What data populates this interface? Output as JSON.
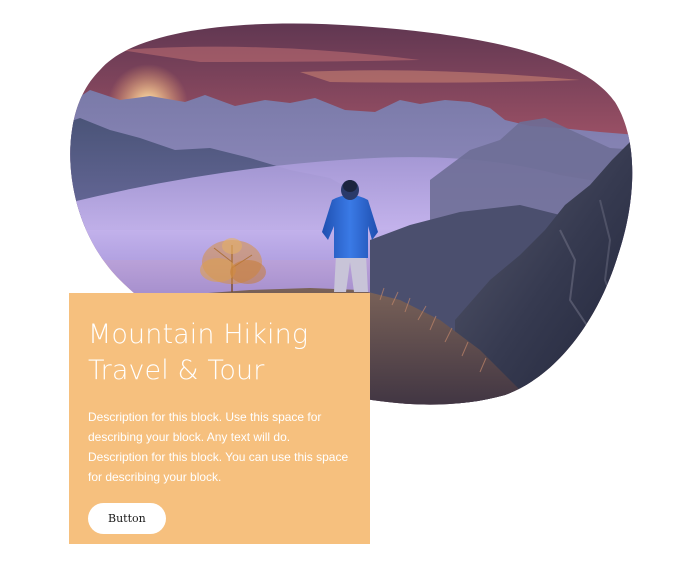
{
  "card": {
    "title": "Mountain Hiking\nTravel & Tour",
    "description": "Description for this block. Use this space for describing your block. Any text will do. Description for this block. You can use this space for describing your block.",
    "button_label": "Button"
  },
  "colors": {
    "card_background": "#f6c07e",
    "button_background": "#ffffff",
    "text_on_card": "#ffffff",
    "sky_top": "#6b3b58",
    "sky_glow": "#f0a060",
    "fog": "#c6b4ee",
    "mountain_dark": "#2a2f45",
    "jacket_blue": "#2f6fd8",
    "tree_orange": "#d9903a"
  }
}
